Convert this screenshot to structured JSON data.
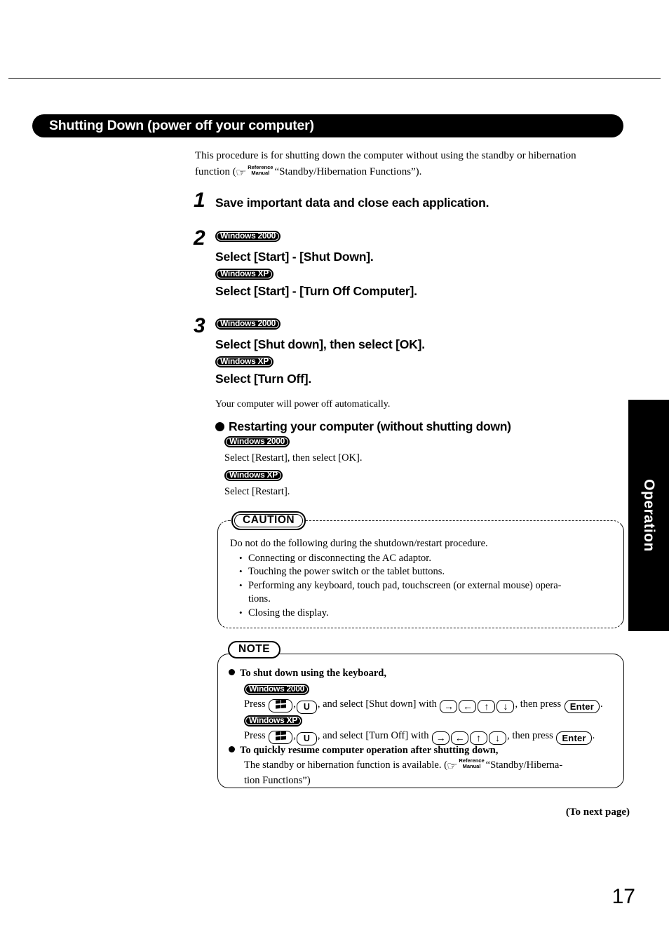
{
  "header": {
    "title": "Shutting Down (power off your computer)"
  },
  "intro": {
    "line1": "This procedure is for shutting down the computer without using the standby or hibernation",
    "line2_prefix": "function (",
    "ref_icon": "pointing-hand-icon",
    "ref_line1": "Reference",
    "ref_line2": "Manual",
    "line2_suffix": "“Standby/Hibernation Functions”)."
  },
  "badges": {
    "win2000": "(Windows)2000)",
    "winxp": "(Windows)XP)"
  },
  "steps": [
    {
      "num": "1",
      "heading": "Save important data and close each application."
    },
    {
      "num": "2",
      "os1_label": "Windows 2000",
      "os1_text": "Select [Start] - [Shut Down].",
      "os2_label": "Windows XP",
      "os2_text": "Select [Start] - [Turn Off Computer]."
    },
    {
      "num": "3",
      "os1_label": "Windows 2000",
      "os1_text": "Select [Shut down], then select [OK].",
      "os2_label": "Windows XP",
      "os2_text": "Select [Turn Off].",
      "note": "Your computer will power off automatically."
    }
  ],
  "restart": {
    "heading": "Restarting your computer (without shutting down)",
    "os1_label": "Windows 2000",
    "os1_text": "Select [Restart], then select [OK].",
    "os2_label": "Windows XP",
    "os2_text": "Select [Restart]."
  },
  "caution": {
    "label": "CAUTION",
    "lead": "Do not do the following during the shutdown/restart procedure.",
    "items": [
      "Connecting or disconnecting the AC adaptor.",
      "Touching the power switch or the tablet buttons.",
      "Performing any keyboard, touch pad, touchscreen (or external mouse) opera-tions.",
      "Closing the display."
    ],
    "item3_line1": "Performing any keyboard, touch pad, touchscreen (or external mouse) opera-",
    "item3_line2": "tions."
  },
  "note": {
    "label": "NOTE",
    "item1_title": "To shut down using the keyboard,",
    "os1_label": "Windows 2000",
    "line1_press": "Press",
    "line1_key_win": "windows-logo-key",
    "line1_comma": ",",
    "line1_key_u": "U",
    "line1_mid": ", and select [Shut down] with",
    "line1_arrow_right": "→",
    "line1_arrow_left": "←",
    "line1_arrow_up": "↑",
    "line1_arrow_down": "↓",
    "line1_then": ", then press",
    "line1_key_enter": "Enter",
    "line1_end": ".",
    "os2_label": "Windows XP",
    "line2_mid": ", and select [Turn Off] with",
    "item2_title": "To quickly resume computer operation after shutting down,",
    "item2_line1": "The standby or hibernation function is available. (",
    "item2_ref1": "Reference",
    "item2_ref2": "Manual",
    "item2_line1_end": "“Standby/Hiberna-",
    "item2_line2": "tion Functions”)"
  },
  "sidetab": {
    "label": "Operation"
  },
  "footer": {
    "to_next_page": "(To next page)",
    "page_number": "17"
  }
}
